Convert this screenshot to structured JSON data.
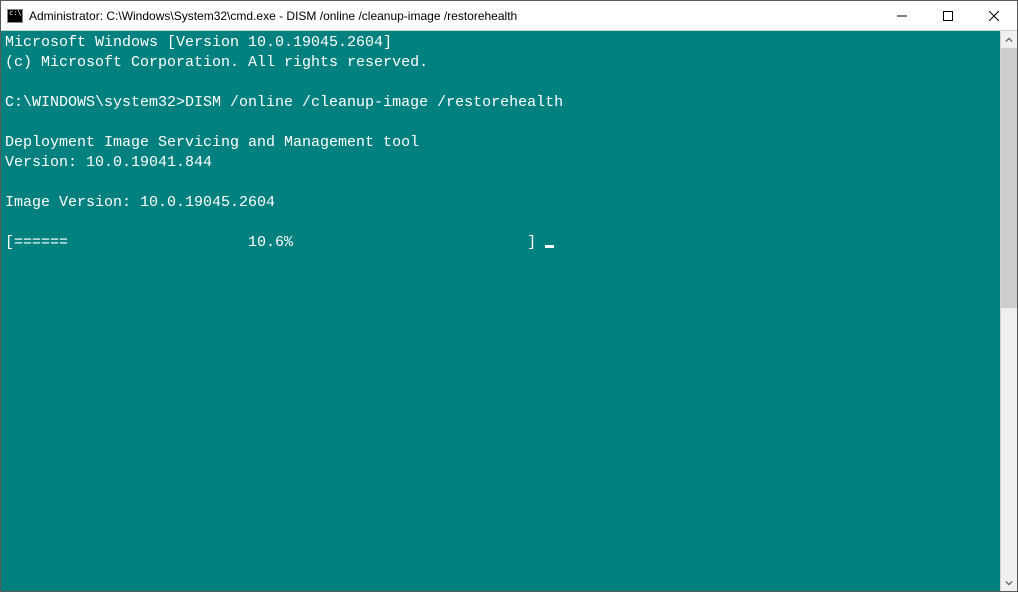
{
  "window": {
    "title": "Administrator: C:\\Windows\\System32\\cmd.exe - DISM  /online /cleanup-image /restorehealth"
  },
  "terminal": {
    "lines": {
      "l1": "Microsoft Windows [Version 10.0.19045.2604]",
      "l2": "(c) Microsoft Corporation. All rights reserved.",
      "l3": "",
      "l4": "C:\\WINDOWS\\system32>DISM /online /cleanup-image /restorehealth",
      "l5": "",
      "l6": "Deployment Image Servicing and Management tool",
      "l7": "Version: 10.0.19041.844",
      "l8": "",
      "l9": "Image Version: 10.0.19045.2604",
      "l10": "",
      "l11": "[======                    10.6%                          ] "
    }
  }
}
